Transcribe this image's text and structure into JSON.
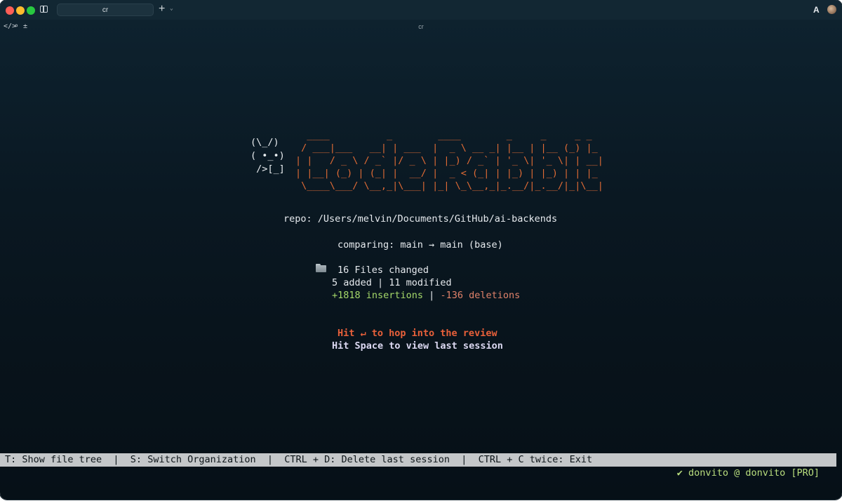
{
  "window": {
    "tab_title": "cr",
    "new_tab": "+",
    "new_tab_menu": "⌄",
    "subtitle": "cr",
    "colors": {
      "background": "#0a1822",
      "accent": "#e06b35"
    }
  },
  "toolbar": {
    "code_icon": "</>",
    "search_icon": "⌕",
    "diff_icon": "±",
    "ai_icon": "A"
  },
  "logo": {
    "mascot": "(\\_/)\n( •_•)\n />[_]",
    "banner": "  ____          _        ____        _     _     _ _   \n / ___|___   __| | ___  |  _ \\ __ _| |__ | |__ (_) |_ \n| |   / _ \\ / _` |/ _ \\ | |_) / _` | '_ \\| '_ \\| | __|\n| |__| (_) | (_| |  __/ |  _ < (_| | |_) | |_) | | |_ \n \\____\\___/ \\__,_|\\___| |_| \\_\\__,_|_.__/|_.__/|_|\\__|"
  },
  "repo": "repo: /Users/melvin/Documents/GitHub/ai-backends",
  "comparing": "comparing: main → main (base)",
  "changes": {
    "files_changed": "16 Files changed",
    "counts": "5 added | 11 modified",
    "insertions": "+1818 insertions",
    "separator": " | ",
    "deletions": "-136 deletions"
  },
  "hints": {
    "review": "Hit ↵ to hop into the review",
    "last_session": "Hit Space to view last session"
  },
  "statusbar": {
    "text": "T: Show file tree  |  S: Switch Organization  |  CTRL + D: Delete last session  |  CTRL + C twice: Exit"
  },
  "user": "✔ donvito @ donvito [PRO]"
}
